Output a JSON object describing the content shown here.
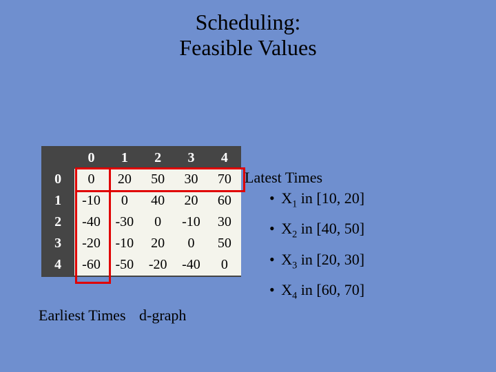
{
  "title_line1": "Scheduling:",
  "title_line2": "Feasible Values",
  "table": {
    "col_headers": [
      "0",
      "1",
      "2",
      "3",
      "4"
    ],
    "row_headers": [
      "0",
      "1",
      "2",
      "3",
      "4"
    ],
    "rows": [
      [
        "0",
        "20",
        "50",
        "30",
        "70"
      ],
      [
        "-10",
        "0",
        "40",
        "20",
        "60"
      ],
      [
        "-40",
        "-30",
        "0",
        "-10",
        "30"
      ],
      [
        "-20",
        "-10",
        "20",
        "0",
        "50"
      ],
      [
        "-60",
        "-50",
        "-20",
        "-40",
        "0"
      ]
    ]
  },
  "latest_label": "Latest Times",
  "latest_items": [
    {
      "var": "X",
      "sub": "1",
      "range": "[10, 20]"
    },
    {
      "var": "X",
      "sub": "2",
      "range": "[40, 50]"
    },
    {
      "var": "X",
      "sub": "3",
      "range": "[20, 30]"
    },
    {
      "var": "X",
      "sub": "4",
      "range": "[60, 70]"
    }
  ],
  "earliest_label": "Earliest Times",
  "dgraph_label": "d-graph",
  "chart_data": {
    "type": "table",
    "title": "d-graph distance matrix",
    "columns": [
      "0",
      "1",
      "2",
      "3",
      "4"
    ],
    "rows": [
      "0",
      "1",
      "2",
      "3",
      "4"
    ],
    "values": [
      [
        0,
        20,
        50,
        30,
        70
      ],
      [
        -10,
        0,
        40,
        20,
        60
      ],
      [
        -40,
        -30,
        0,
        -10,
        30
      ],
      [
        -20,
        -10,
        20,
        0,
        50
      ],
      [
        -60,
        -50,
        -20,
        -40,
        0
      ]
    ],
    "earliest_times_column": 0,
    "latest_times_row": 0,
    "feasible_intervals": {
      "X1": [
        10,
        20
      ],
      "X2": [
        40,
        50
      ],
      "X3": [
        20,
        30
      ],
      "X4": [
        60,
        70
      ]
    }
  }
}
